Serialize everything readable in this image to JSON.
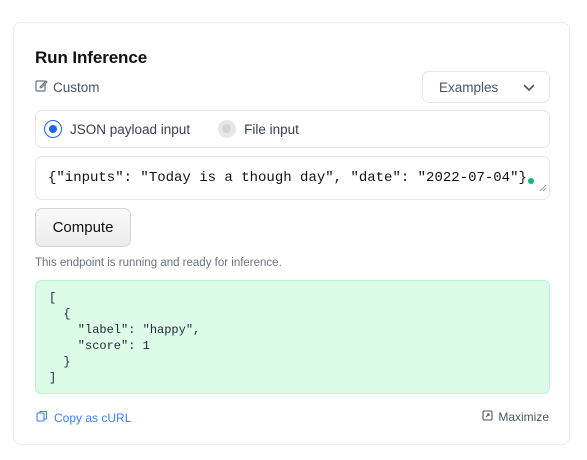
{
  "widget": {
    "title": "Run Inference",
    "custom_label": "Custom",
    "examples_label": "Examples",
    "input_modes": [
      {
        "label": "JSON payload input",
        "selected": true
      },
      {
        "label": "File input",
        "selected": false
      }
    ],
    "json_input_value": "{\"inputs\": \"Today is a though day\", \"date\": \"2022-07-04\"}",
    "compute_label": "Compute",
    "status_text": "This endpoint is running and ready for inference.",
    "output_text": "[\n  {\n    \"label\": \"happy\",\n    \"score\": 1\n  }\n]",
    "copy_curl_label": "Copy as cURL",
    "maximize_label": "Maximize"
  },
  "colors": {
    "accent": "#2563eb",
    "output_bg": "#dcfce7",
    "link": "#3b82f6"
  },
  "icons": {
    "custom": "edit-icon",
    "examples": "chevron-down-icon",
    "copy": "copy-icon",
    "maximize": "maximize-icon"
  }
}
